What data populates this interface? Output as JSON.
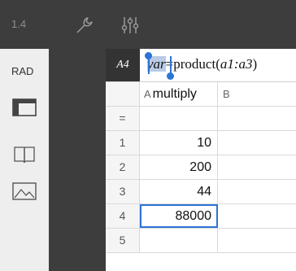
{
  "toolbar": {
    "tab_label": "1.4",
    "icons": [
      "wrench-icon",
      "sliders-icon"
    ]
  },
  "sidebar": {
    "angle_mode": "RAD",
    "icons": [
      "layout-icon",
      "book-icon",
      "image-icon"
    ]
  },
  "formula_bar": {
    "cell_ref": "A4",
    "selected_text": "var",
    "formula_part1": "=product(",
    "formula_arg": "a1:a3",
    "formula_close": ")"
  },
  "grid": {
    "column_a_letter": "A",
    "column_a_name": "multiply",
    "column_b_letter": "B",
    "formula_row_label": "=",
    "rows": [
      {
        "num": "1",
        "a": "10"
      },
      {
        "num": "2",
        "a": "200"
      },
      {
        "num": "3",
        "a": "44"
      },
      {
        "num": "4",
        "a": "88000"
      },
      {
        "num": "5",
        "a": ""
      }
    ]
  },
  "colors": {
    "toolbar_bg": "#3d3d3d",
    "sidebar_bg": "#eeeeee",
    "selection_accent": "#2c74d6",
    "text_selection_bg": "#b9cbe6"
  }
}
